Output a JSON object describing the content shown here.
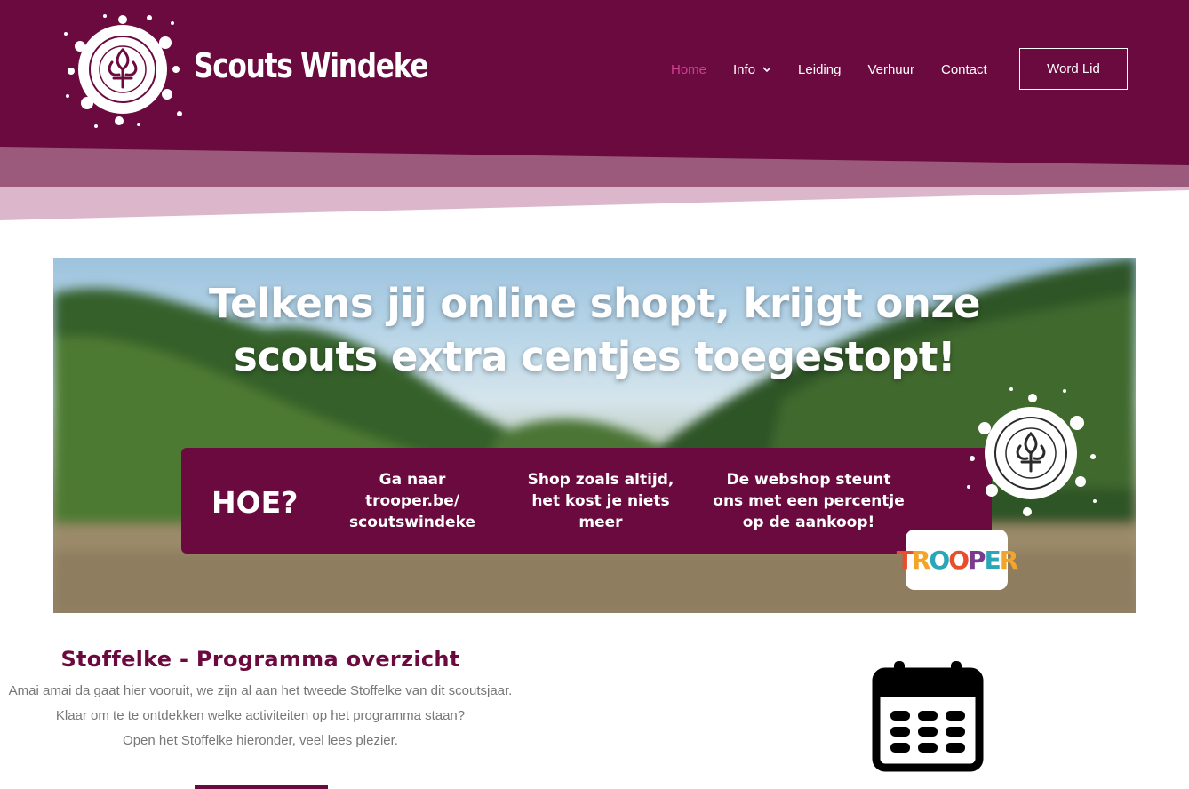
{
  "site": {
    "title": "Scouts Windeke",
    "logo_text": "Scouts Sint-Kristoffel Scheldewindeke",
    "brand_color": "#6b0a3e"
  },
  "nav": {
    "items": [
      {
        "label": "Home",
        "active": true
      },
      {
        "label": "Info",
        "has_dropdown": true
      },
      {
        "label": "Leiding"
      },
      {
        "label": "Verhuur"
      },
      {
        "label": "Contact"
      }
    ],
    "cta_label": "Word Lid"
  },
  "banner": {
    "headline_line1": "Telkens jij online shopt, krijgt onze",
    "headline_line2": "scouts extra centjes toegestopt!",
    "hoe_title": "HOE?",
    "steps": [
      {
        "l1": "Ga naar",
        "l2": "trooper.be/",
        "l3": "scoutswindeke"
      },
      {
        "l1": "Shop zoals altijd,",
        "l2": "het kost je niets",
        "l3": "meer"
      },
      {
        "l1": "De webshop steunt",
        "l2": "ons met een percentje",
        "l3": "op de aankoop!"
      }
    ],
    "trooper_logo": "TROOPER"
  },
  "program": {
    "title": "Stoffelke - Programma overzicht",
    "line1": "Amai amai da gaat hier vooruit, we zijn al aan het tweede Stoffelke van dit scoutsjaar.",
    "line2": "Klaar om te te ontdekken welke activiteiten op het programma staan?",
    "line3": "Open het Stoffelke hieronder, veel lees plezier.",
    "icon": "calendar-icon"
  }
}
